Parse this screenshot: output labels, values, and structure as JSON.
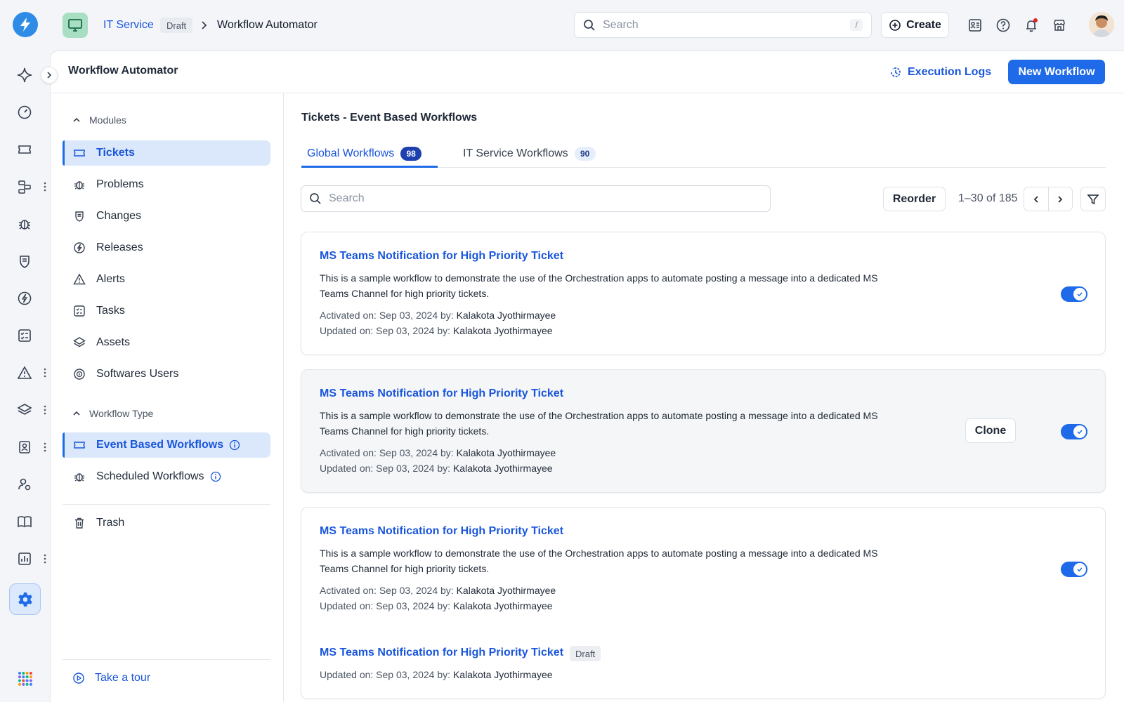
{
  "topbar": {
    "module_name": "IT Service",
    "module_status": "Draft",
    "current_page": "Workflow Automator",
    "search_placeholder": "Search",
    "search_shortcut": "/",
    "create_label": "Create"
  },
  "header": {
    "title": "Workflow Automator",
    "execution_logs_label": "Execution Logs",
    "new_workflow_label": "New Workflow"
  },
  "sidebar": {
    "modules_heading": "Modules",
    "modules": [
      {
        "label": "Tickets",
        "icon": "ticket-icon",
        "active": true
      },
      {
        "label": "Problems",
        "icon": "bug-icon"
      },
      {
        "label": "Changes",
        "icon": "shield-icon"
      },
      {
        "label": "Releases",
        "icon": "rocket-icon"
      },
      {
        "label": "Alerts",
        "icon": "warning-icon"
      },
      {
        "label": "Tasks",
        "icon": "checklist-icon"
      },
      {
        "label": "Assets",
        "icon": "layers-icon"
      },
      {
        "label": "Softwares Users",
        "icon": "software-icon"
      }
    ],
    "workflow_type_heading": "Workflow Type",
    "workflow_types": [
      {
        "label": "Event Based Workflows",
        "active": true
      },
      {
        "label": "Scheduled Workflows"
      }
    ],
    "trash_label": "Trash",
    "tour_label": "Take a tour"
  },
  "content": {
    "title": "Tickets - Event Based Workflows",
    "tabs": [
      {
        "label": "Global Workflows",
        "count": "98"
      },
      {
        "label": "IT Service Workflows",
        "count": "90"
      }
    ],
    "search_placeholder": "Search",
    "reorder_label": "Reorder",
    "page_info": "1–30 of 185",
    "clone_label": "Clone",
    "workflows": [
      {
        "title": "MS Teams Notification for High Priority Ticket",
        "description": "This is a sample workflow to demonstrate the use of the Orchestration apps to automate posting a message into a dedicated MS Teams Channel for high priority tickets.",
        "activated_on": "Activated on: Sep 03, 2024 by: ",
        "activated_by": "Kalakota Jyothirmayee",
        "updated_on": "Updated on: Sep 03, 2024 by: ",
        "updated_by": "Kalakota Jyothirmayee",
        "enabled": true
      },
      {
        "title": "MS Teams Notification for High Priority Ticket",
        "description": "This is a sample workflow to demonstrate the use of the Orchestration apps to automate posting a message into a dedicated MS Teams Channel for high priority tickets.",
        "activated_on": "Activated on: Sep 03, 2024 by: ",
        "activated_by": "Kalakota Jyothirmayee",
        "updated_on": "Updated on: Sep 03, 2024 by: ",
        "updated_by": "Kalakota Jyothirmayee",
        "enabled": true
      },
      {
        "title": "MS Teams Notification for High Priority Ticket",
        "description": "This is a sample workflow to demonstrate the use of the Orchestration apps to automate posting a message into a dedicated MS Teams Channel for high priority tickets.",
        "activated_on": "Activated on: Sep 03, 2024 by: ",
        "activated_by": "Kalakota Jyothirmayee",
        "updated_on": "Updated on: Sep 03, 2024 by: ",
        "updated_by": "Kalakota Jyothirmayee",
        "enabled": true
      },
      {
        "title": "MS Teams Notification for High Priority Ticket",
        "status": "Draft",
        "updated_on": "Updated on: Sep 03, 2024 by: ",
        "updated_by": "Kalakota Jyothirmayee"
      }
    ]
  },
  "colors": {
    "accent": "#1e6ae8",
    "link": "#1a56db",
    "active_nav_bg": "#dbe8fb"
  }
}
